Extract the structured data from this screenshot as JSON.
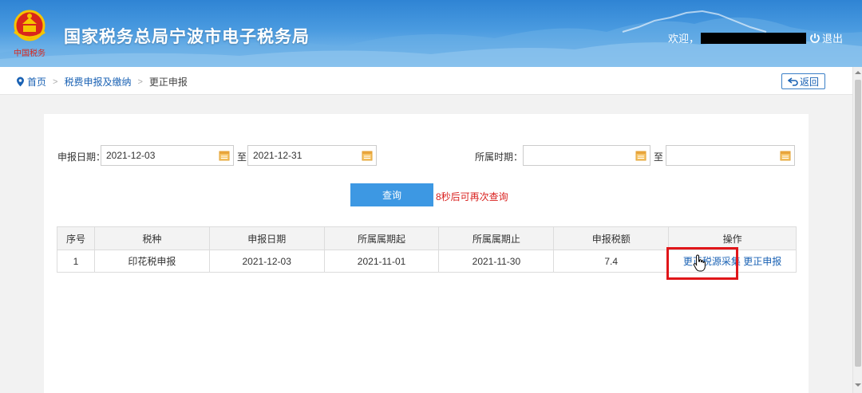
{
  "header": {
    "site_title": "国家税务总局宁波市电子税务局",
    "welcome": "欢迎，",
    "logout_label": "退出"
  },
  "breadcrumb": {
    "home": "首页",
    "section": "税费申报及缴纳",
    "current": "更正申报",
    "separator": ">"
  },
  "back_button": {
    "label": "返回"
  },
  "search": {
    "report_date_label": "申报日期：",
    "report_date_from": "2021-12-03",
    "report_date_to": "2021-12-31",
    "to_label": "至",
    "period_label": "所属时期：",
    "period_from": "",
    "period_to": "",
    "query_label": "查询",
    "retry_note": "8秒后可再次查询"
  },
  "table": {
    "headers": [
      "序号",
      "税种",
      "申报日期",
      "所属属期起",
      "所属属期止",
      "申报税额",
      "操作"
    ],
    "rows": [
      {
        "index": "1",
        "tax_type": "印花税申报",
        "report_date": "2021-12-03",
        "period_start": "2021-11-01",
        "period_end": "2021-11-30",
        "amount": "7.4",
        "action_collect": "更正税源采集",
        "action_correct": "更正申报"
      }
    ]
  },
  "colors": {
    "brand_blue": "#2f84d4",
    "link_blue": "#1a62b4",
    "button_blue": "#3d98e3",
    "highlight_red": "#e0161a",
    "note_red": "#d9211f"
  }
}
